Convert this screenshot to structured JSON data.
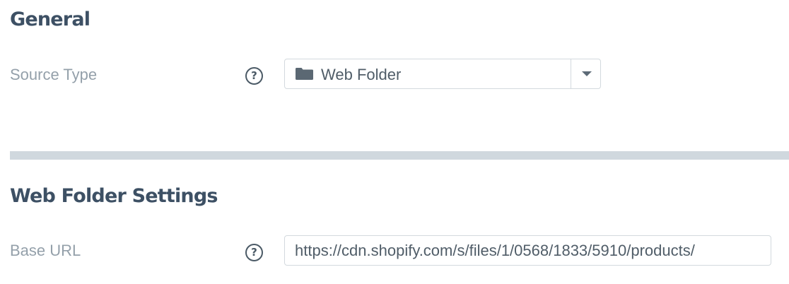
{
  "general": {
    "title": "General",
    "source_type": {
      "label": "Source Type",
      "help_glyph": "?",
      "help_icon": "question-circle-icon",
      "selected_icon": "folder-icon",
      "selected_value": "Web Folder",
      "dropdown_icon": "caret-down-icon"
    }
  },
  "web_folder_settings": {
    "title": "Web Folder Settings",
    "base_url": {
      "label": "Base URL",
      "help_glyph": "?",
      "help_icon": "question-circle-icon",
      "value": "https://cdn.shopify.com/s/files/1/0568/1833/5910/products/"
    }
  },
  "colors": {
    "heading": "#3d5064",
    "label": "#94a0aa",
    "input_text": "#505d68",
    "border": "#d3d9de",
    "divider": "#d0d8de"
  }
}
